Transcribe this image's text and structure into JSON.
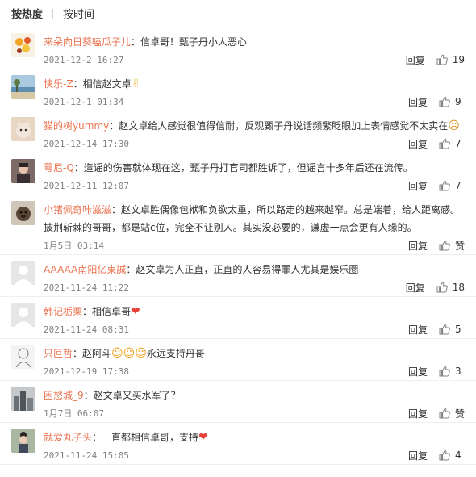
{
  "tabs": [
    {
      "label": "按热度",
      "active": true
    },
    {
      "label": "按时间",
      "active": false
    }
  ],
  "reply_label": "回复",
  "comments": [
    {
      "user": "来朵向日葵嗑瓜子儿",
      "text": "信卓哥！甄子丹小人恶心",
      "time": "2021-12-2 16:27",
      "likes": "19",
      "avatar": "flowers"
    },
    {
      "user": "快乐-Z",
      "text": "相信赵文卓",
      "emoji": "hand",
      "time": "2021-12-1 01:34",
      "likes": "9",
      "avatar": "beach"
    },
    {
      "user": "猫的树yummy",
      "text": "赵文卓给人感觉很值得信耐，反观甄子丹说话频繁眨眼加上表情感觉不太实在",
      "emoji": "cat",
      "time": "2021-12-14 17:30",
      "likes": "7",
      "avatar": "cat"
    },
    {
      "user": "萼尼-Q",
      "text": "造谣的伤害就体现在这，甄子丹打官司都胜诉了，但谣言十多年后还在流传。",
      "time": "2021-12-11 12:07",
      "likes": "7",
      "avatar": "person"
    },
    {
      "user": "小猪佩奇咔滋滋",
      "text": "赵文卓胜偶像包袱和负欲太重，所以路走的越来越窄。总是端着，给人距离感。披荆斩棘的哥哥，都是站c位，完全不让别人。其实没必要的，谦虚一点会更有人缘的。",
      "time": "1月5日 03:14",
      "likes": "赞",
      "avatar": "dog"
    },
    {
      "user": "AAAAA南阳亿東誠",
      "text": "赵文卓为人正直，正直的人容易得罪人尤其是娱乐圈",
      "time": "2021-11-24 11:22",
      "likes": "18",
      "avatar": "default"
    },
    {
      "user": "韩记栃栗",
      "text": "相信卓哥",
      "emoji": "heart",
      "time": "2021-11-24 08:31",
      "likes": "5",
      "avatar": "default"
    },
    {
      "user": "只叵哲",
      "text": "赵阿斗",
      "emoji": "laugh3",
      "text2": "永远支持丹哥",
      "time": "2021-12-19 17:38",
      "likes": "3",
      "avatar": "sketch"
    },
    {
      "user": "困愁城_9",
      "text": "赵文卓又买水军了？",
      "time": "1月7日 06:07",
      "likes": "赞",
      "avatar": "city"
    },
    {
      "user": "就爱丸子头",
      "text": "一直都相信卓哥，支持",
      "emoji": "heart",
      "time": "2021-11-24 15:05",
      "likes": "4",
      "avatar": "girl"
    }
  ]
}
